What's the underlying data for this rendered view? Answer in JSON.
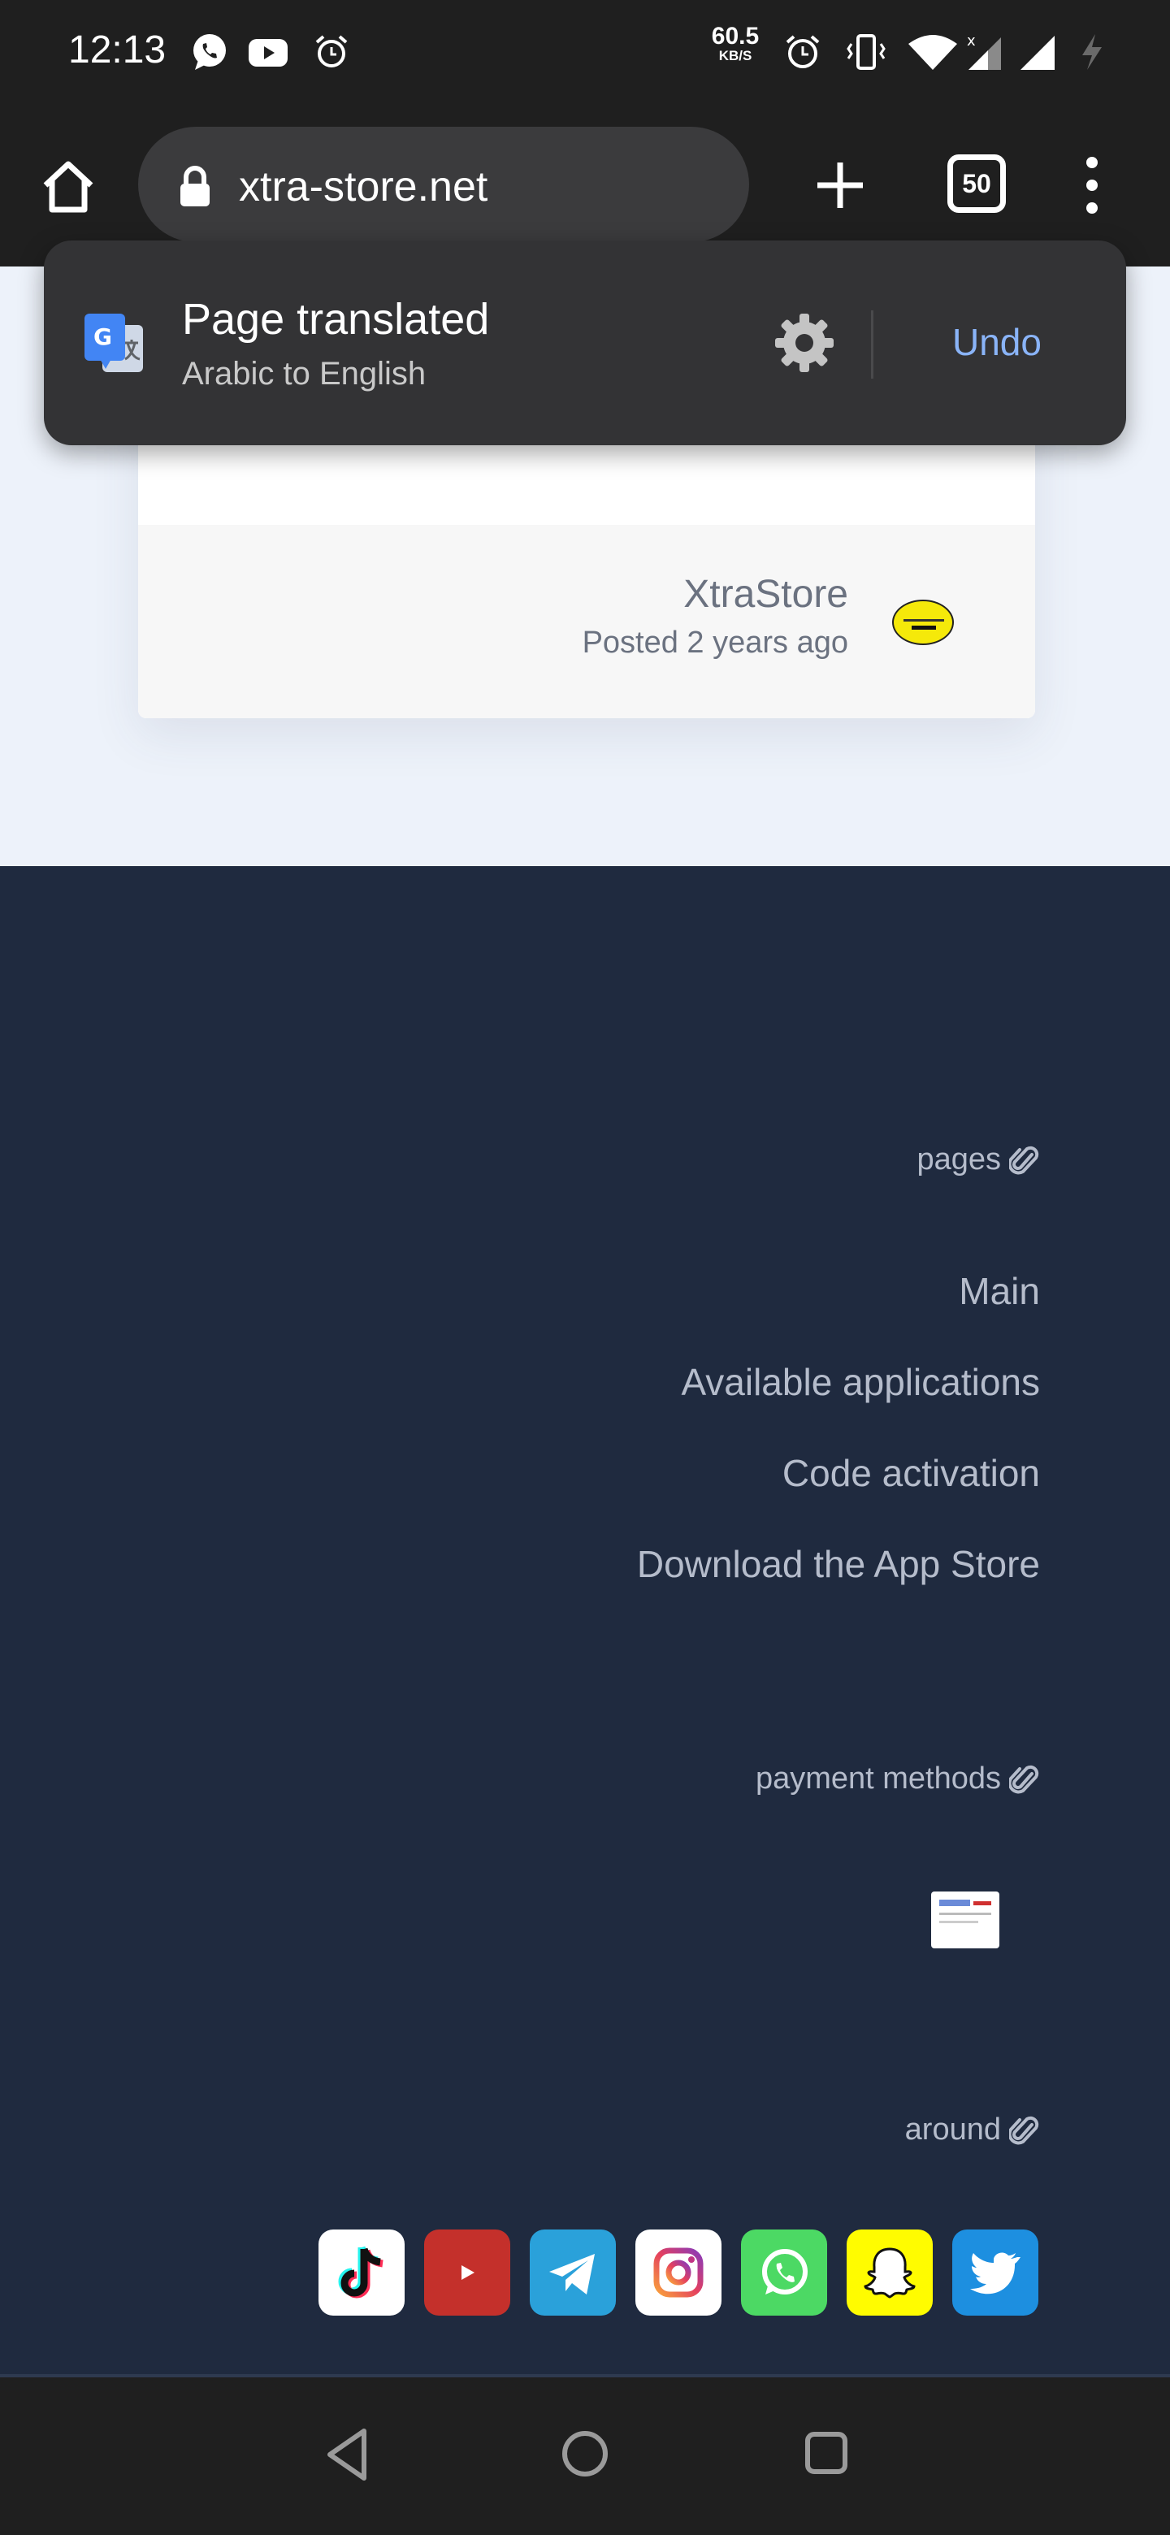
{
  "status_bar": {
    "time": "12:13",
    "net_speed_value": "60.5",
    "net_speed_unit": "KB/S",
    "icons": [
      "whatsapp-icon",
      "youtube-icon",
      "alarm-icon",
      "alarm-icon",
      "vibrate-icon",
      "wifi-icon",
      "signal-icon",
      "signal-icon",
      "battery-charging-icon"
    ]
  },
  "toolbar": {
    "url": "xtra-store.net",
    "tab_count": "50",
    "icons": [
      "home-icon",
      "lock-icon",
      "plus-icon",
      "more-vert-icon"
    ]
  },
  "translate_popup": {
    "title": "Page translated",
    "subtitle": "Arabic to English",
    "undo_label": "Undo",
    "icons": [
      "google-translate-icon",
      "gear-icon"
    ]
  },
  "post": {
    "author": "XtraStore",
    "posted": "Posted 2 years ago"
  },
  "footer": {
    "pages_heading": "pages",
    "pages_links": [
      "Main",
      "Available applications",
      "Code activation",
      "Download the App Store"
    ],
    "payment_heading": "payment methods",
    "around_heading": "around",
    "social": [
      "tiktok-icon",
      "youtube-icon",
      "telegram-icon",
      "instagram-icon",
      "whatsapp-icon",
      "snapchat-icon",
      "twitter-icon"
    ],
    "colors": {
      "background": "#1f2a3f",
      "text": "#b5bccb",
      "youtube": "#c4302b",
      "telegram": "#2aa1da",
      "whatsapp": "#4cd964",
      "snapchat": "#fffc00",
      "twitter": "#1d8fe0"
    }
  },
  "nav_bar": {
    "icons": [
      "back-icon",
      "home-circle-icon",
      "recents-icon"
    ]
  }
}
